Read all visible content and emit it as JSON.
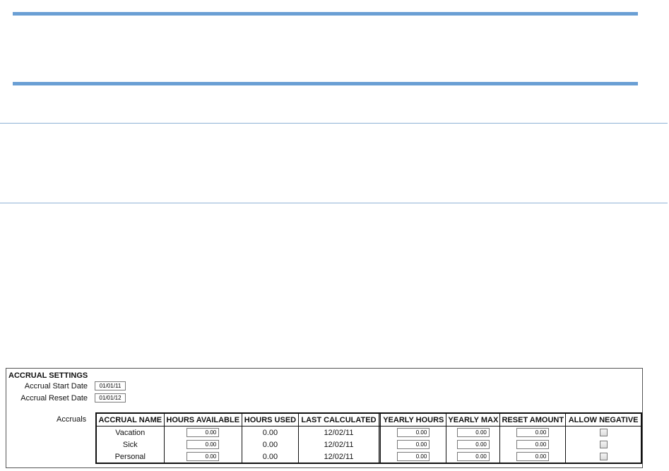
{
  "accrual_settings": {
    "title": "ACCRUAL SETTINGS",
    "start_date": {
      "label": "Accrual Start Date",
      "value": "01/01/11"
    },
    "reset_date": {
      "label": "Accrual Reset Date",
      "value": "01/01/12"
    },
    "accruals_label": "Accruals",
    "columns": {
      "name": "ACCRUAL NAME",
      "hours_available": "HOURS AVAILABLE",
      "hours_used": "HOURS USED",
      "last_calculated": "LAST CALCULATED",
      "yearly_hours": "YEARLY HOURS",
      "yearly_max": "YEARLY MAX",
      "reset_amount": "RESET AMOUNT",
      "allow_negative": "ALLOW NEGATIVE"
    },
    "rows": [
      {
        "name": "Vacation",
        "hours_available": "0.00",
        "hours_used": "0.00",
        "last_calculated": "12/02/11",
        "yearly_hours": "0.00",
        "yearly_max": "0.00",
        "reset_amount": "0.00",
        "allow_negative": false
      },
      {
        "name": "Sick",
        "hours_available": "0.00",
        "hours_used": "0.00",
        "last_calculated": "12/02/11",
        "yearly_hours": "0.00",
        "yearly_max": "0.00",
        "reset_amount": "0.00",
        "allow_negative": false
      },
      {
        "name": "Personal",
        "hours_available": "0.00",
        "hours_used": "0.00",
        "last_calculated": "12/02/11",
        "yearly_hours": "0.00",
        "yearly_max": "0.00",
        "reset_amount": "0.00",
        "allow_negative": false
      }
    ]
  },
  "colors": {
    "rule_blue": "#6a9fd4",
    "border_dark": "#111111"
  }
}
